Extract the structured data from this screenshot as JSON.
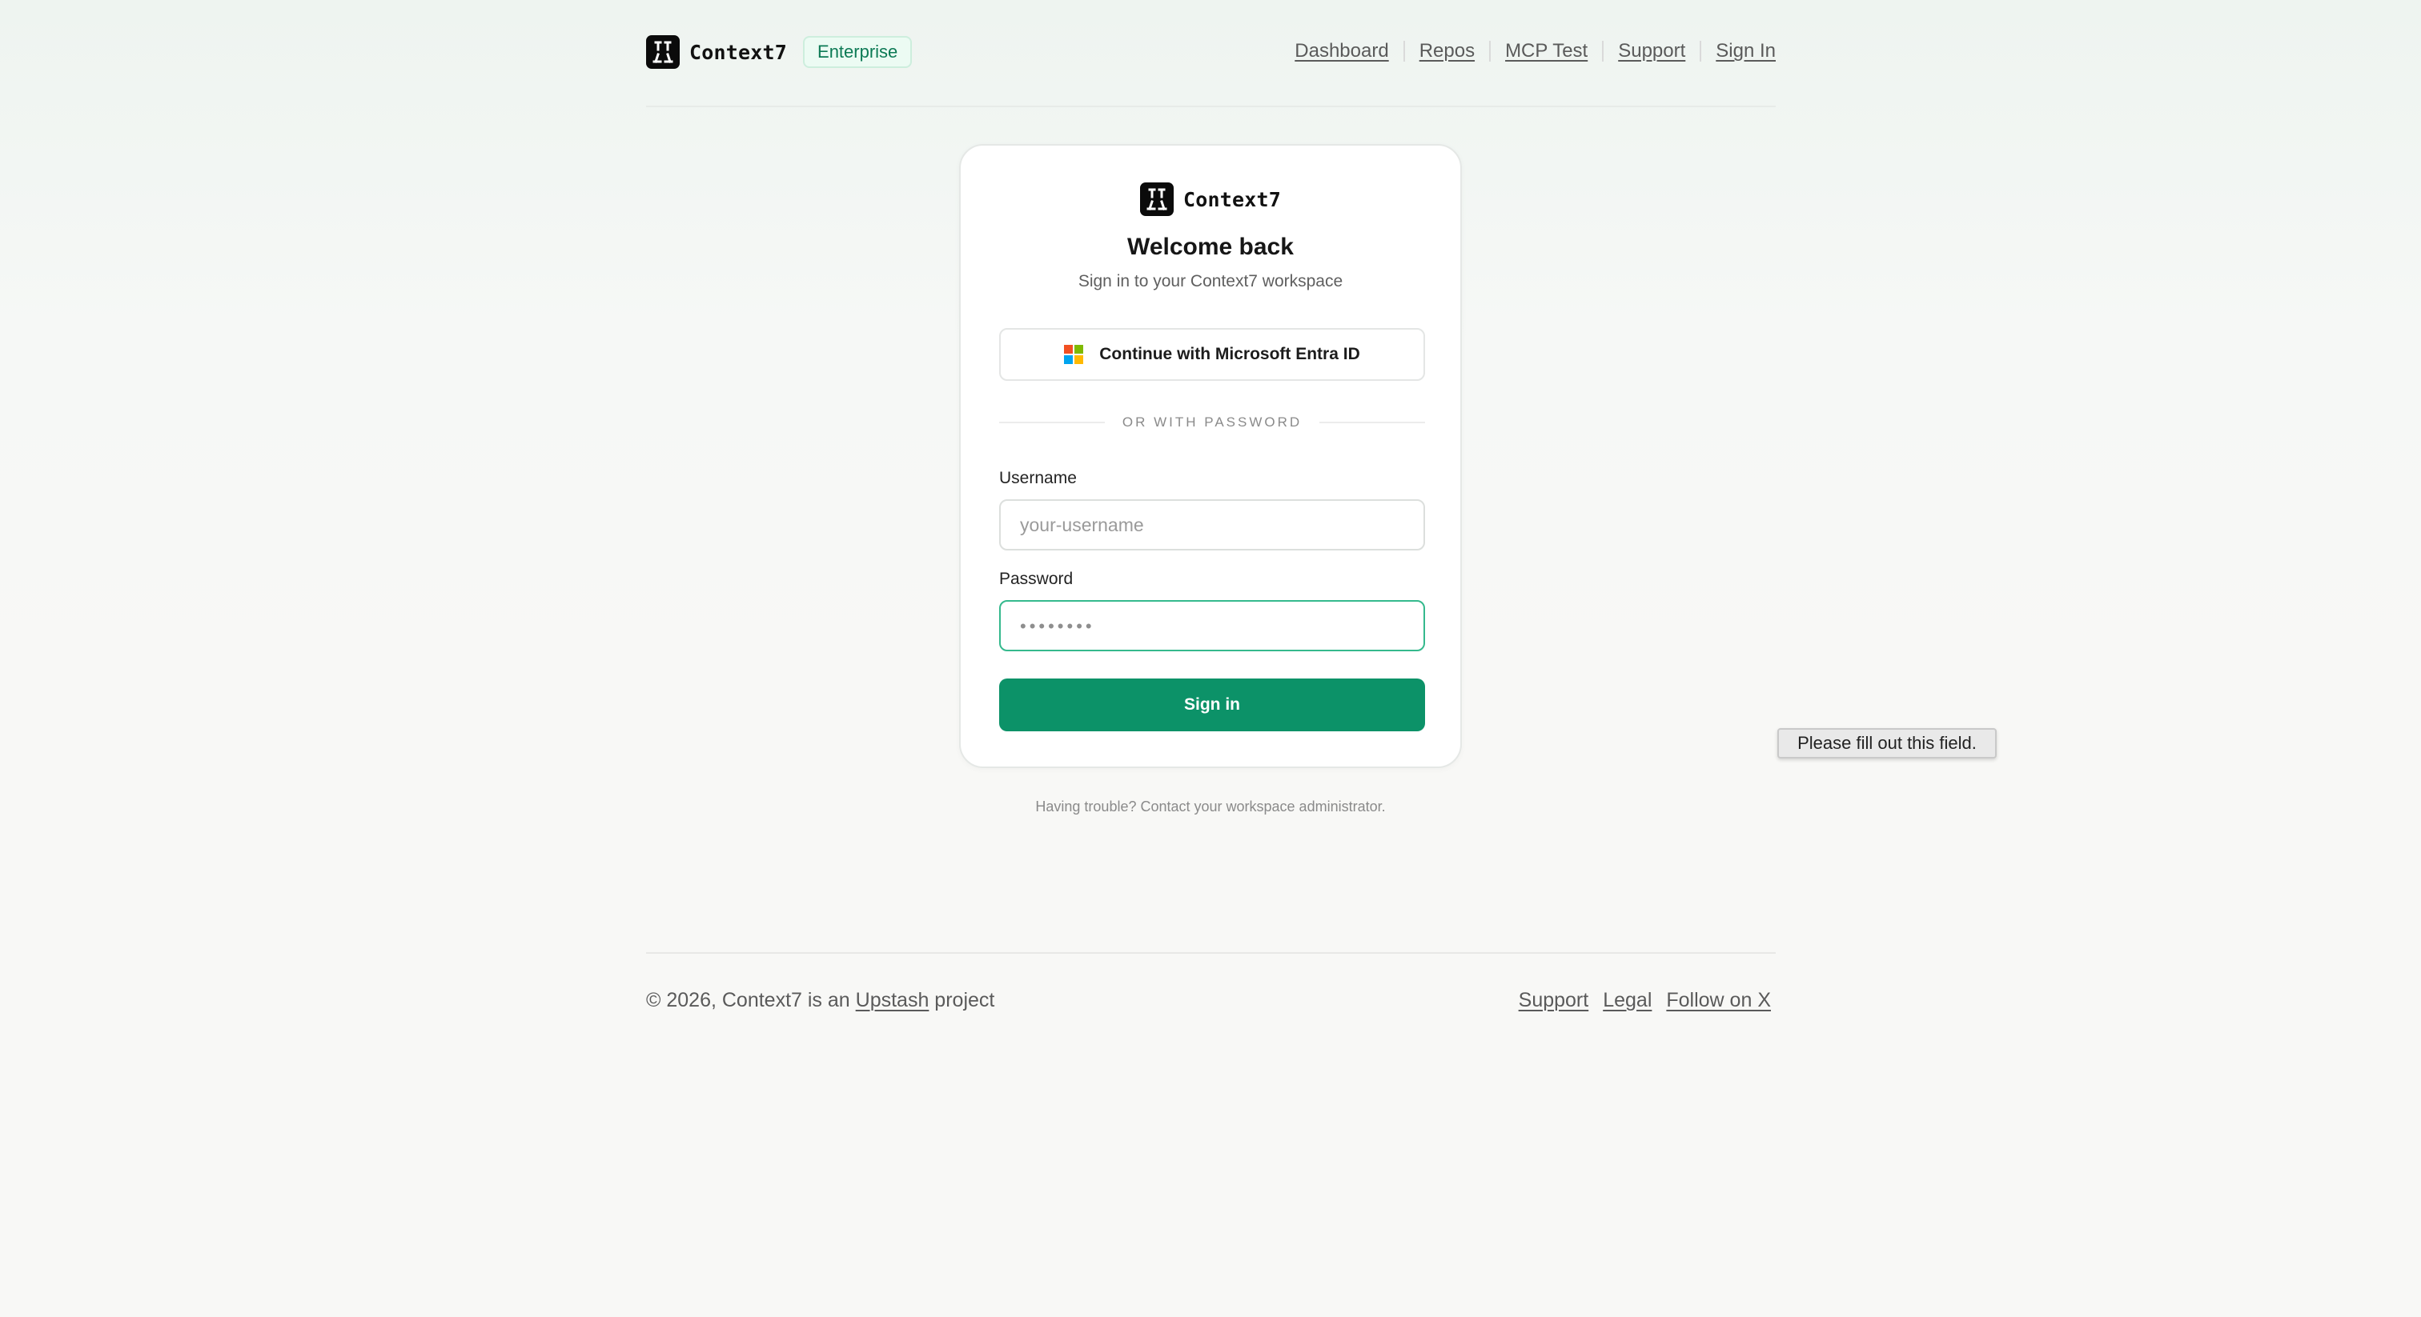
{
  "header": {
    "brand_name": "Context7",
    "badge": "Enterprise",
    "nav": [
      {
        "label": "Dashboard"
      },
      {
        "label": "Repos"
      },
      {
        "label": "MCP Test"
      },
      {
        "label": "Support"
      },
      {
        "label": "Sign In"
      }
    ]
  },
  "login_card": {
    "brand_name": "Context7",
    "title": "Welcome back",
    "subtitle": "Sign in to your Context7 workspace",
    "sso_button_label": "Continue with Microsoft Entra ID",
    "sso_icon": "microsoft-logo",
    "divider_text": "OR WITH PASSWORD",
    "username": {
      "label": "Username",
      "placeholder": "your-username",
      "value": ""
    },
    "password": {
      "label": "Password",
      "placeholder": "••••••••",
      "value": ""
    },
    "submit_label": "Sign in"
  },
  "help_text": "Having trouble? Contact your workspace administrator.",
  "validation_tooltip": "Please fill out this field.",
  "footer": {
    "copyright_prefix": "© 2026, Context7 is an ",
    "copyright_link": "Upstash",
    "copyright_suffix": " project",
    "links": [
      {
        "label": "Support"
      },
      {
        "label": "Legal"
      },
      {
        "label": "Follow on X"
      }
    ]
  },
  "colors": {
    "accent": "#0c9268",
    "badge_bg": "#ecfbf3",
    "badge_text": "#0d7a55",
    "focus_border": "#35b98d",
    "ms_red": "#f25022",
    "ms_green": "#7fba00",
    "ms_blue": "#00a4ef",
    "ms_yellow": "#ffb900"
  }
}
